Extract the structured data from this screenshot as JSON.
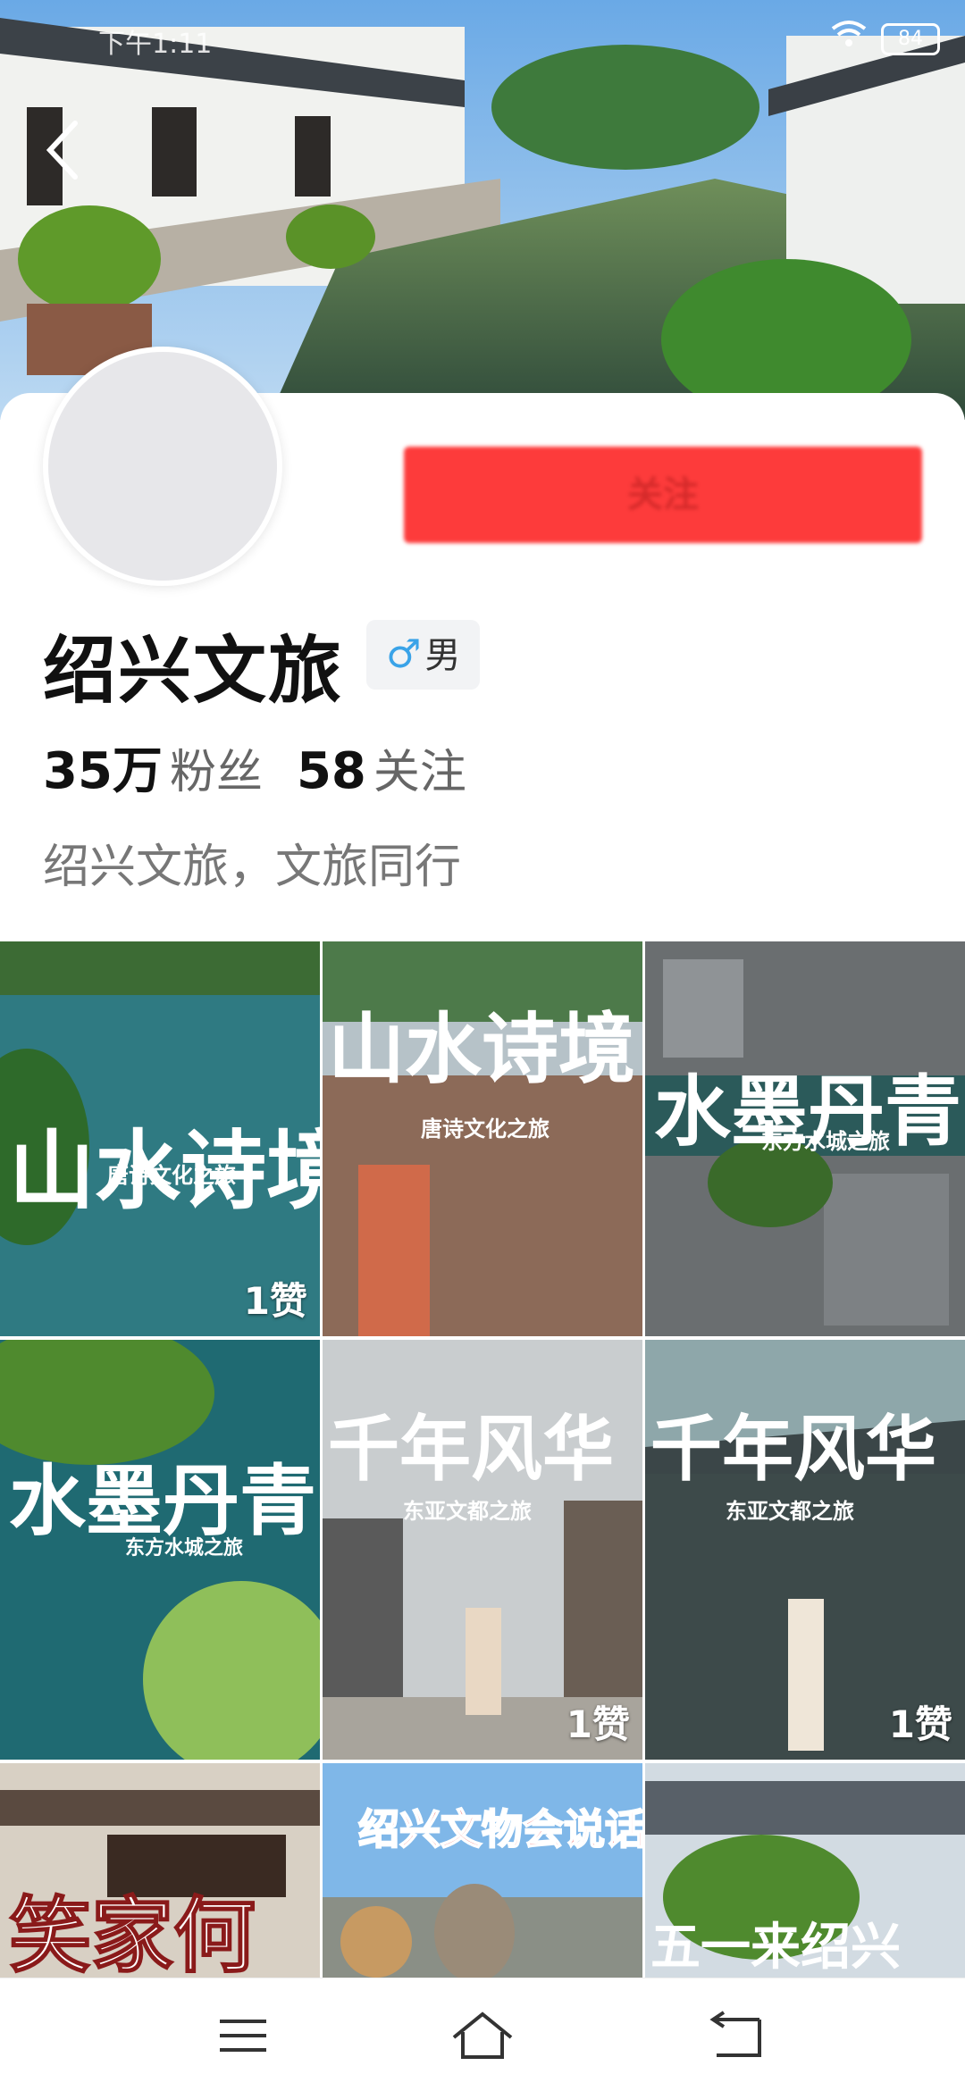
{
  "status_bar": {
    "time": "下午1:11",
    "battery": "84"
  },
  "profile": {
    "follow_button_label": "关注",
    "name": "绍兴文旅",
    "gender_symbol": "♂",
    "gender": "男",
    "followers_count": "35万",
    "followers_label": "粉丝",
    "following_count": "58",
    "following_label": "关注",
    "bio": "绍兴文旅，文旅同行"
  },
  "videos": [
    {
      "title_big": "山水诗境",
      "subtitle": "唐诗文化之旅",
      "likes": "1赞"
    },
    {
      "title_big": "山水诗境",
      "subtitle": "唐诗文化之旅",
      "likes": ""
    },
    {
      "title_big": "水墨丹青",
      "subtitle": "东方水城之旅",
      "likes": ""
    },
    {
      "title_big": "水墨丹青",
      "subtitle": "东方水城之旅",
      "likes": ""
    },
    {
      "title_big": "千年风华",
      "subtitle": "东亚文都之旅",
      "likes": "1赞"
    },
    {
      "title_big": "千年风华",
      "subtitle": "东亚文都之旅",
      "likes": "1赞"
    },
    {
      "title_big": "笑家何",
      "subtitle": "",
      "likes": ""
    },
    {
      "title_big": "绍兴文物会说话",
      "subtitle": "",
      "likes": ""
    },
    {
      "title_big": "五一来绍兴",
      "subtitle": "",
      "likes": ""
    }
  ],
  "nav": {
    "menu": "menu-icon",
    "home": "home-icon",
    "back": "back-icon"
  }
}
